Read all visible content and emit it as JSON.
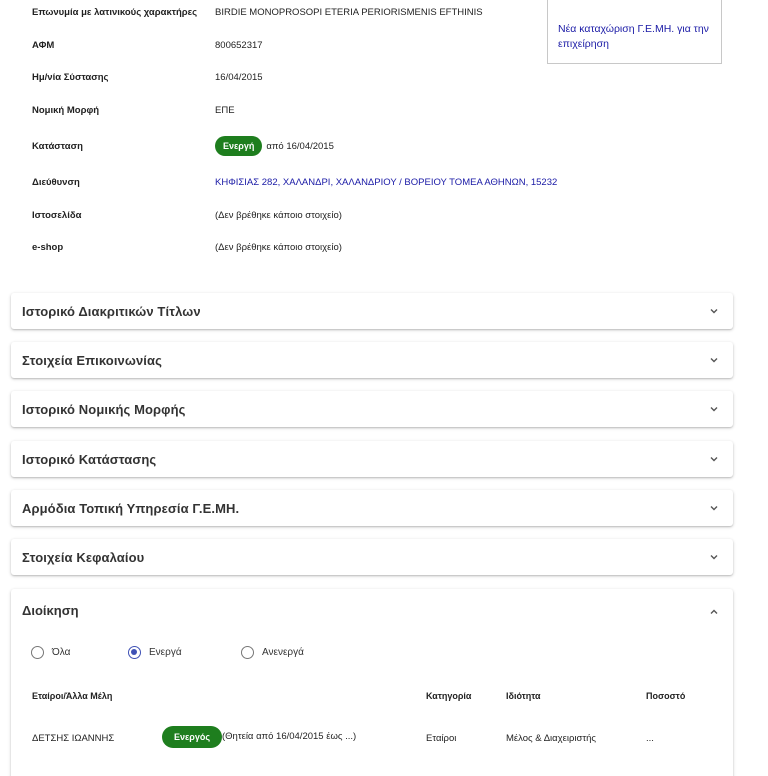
{
  "side_card": {
    "link_text": "Νέα καταχώριση Γ.Ε.ΜΗ. για την επιχείρηση"
  },
  "info": [
    {
      "label": "Επωνυμία με λατινικούς χαρακτήρες",
      "value": "BIRDIE MONOPROSOPI ETERIA PERIORISMENIS EFTHINIS"
    },
    {
      "label": "ΑΦΜ",
      "value": "800652317"
    },
    {
      "label": "Ημ/νία Σύστασης",
      "value": "16/04/2015"
    },
    {
      "label": "Νομική Μορφή",
      "value": "ΕΠΕ"
    },
    {
      "label": "Κατάσταση",
      "badge": "Ενεργή",
      "value": "από 16/04/2015"
    },
    {
      "label": "Διεύθυνση",
      "value": "ΚΗΦΙΣΙΑΣ 282, ΧΑΛΑΝΔΡΙ, ΧΑΛΑΝΔΡΙΟΥ / ΒΟΡΕΙΟΥ ΤΟΜΕΑ ΑΘΗΝΩΝ, 15232"
    },
    {
      "label": "Ιστοσελίδα",
      "value": "(Δεν βρέθηκε κάποιο στοιχείο)"
    },
    {
      "label": "e-shop",
      "value": "(Δεν βρέθηκε κάποιο στοιχείο)"
    }
  ],
  "accordions": [
    "Ιστορικό Διακριτικών Τίτλων",
    "Στοιχεία Επικοινωνίας",
    "Ιστορικό Νομικής Μορφής",
    "Ιστορικό Κατάστασης",
    "Αρμόδια Τοπική Υπηρεσία Γ.Ε.ΜΗ.",
    "Στοιχεία Κεφαλαίου"
  ],
  "management": {
    "title": "Διοίκηση",
    "filters": {
      "all": "Όλα",
      "active": "Ενεργά",
      "inactive": "Ανενεργά",
      "selected": "Ενεργά"
    },
    "columns": {
      "members": "Εταίροι/Άλλα Μέλη",
      "category": "Κατηγορία",
      "capacity": "Ιδιότητα",
      "percentage": "Ποσοστό"
    },
    "rows": [
      {
        "name": "ΔΕΤΣΗΣ ΙΩΑΝΝΗΣ",
        "badge": "Ενεργός",
        "term": "(Θητεία από 16/04/2015 έως ...)",
        "category": "Εταίροι",
        "capacity": "Μέλος & Διαχειριστής",
        "percentage": "..."
      }
    ]
  },
  "colors": {
    "badge_green": "#1e7e1e",
    "link_blue": "#1a1aa6",
    "radio_accent": "#3f51b5"
  }
}
